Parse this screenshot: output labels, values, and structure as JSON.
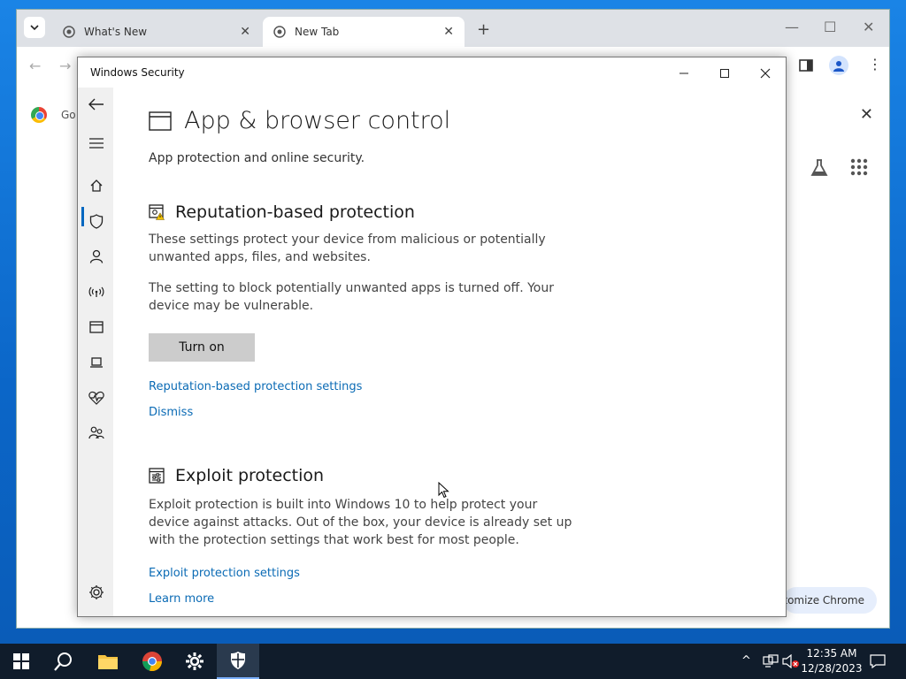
{
  "chrome": {
    "tabs": [
      {
        "label": "What's New"
      },
      {
        "label": "New Tab"
      }
    ],
    "bookmark_partial": "Go",
    "customize_label": "tomize Chrome"
  },
  "ws": {
    "window_title": "Windows Security",
    "page_title": "App & browser control",
    "page_subtitle": "App protection and online security.",
    "reputation": {
      "title": "Reputation-based protection",
      "desc": "These settings protect your device from malicious or potentially unwanted apps, files, and websites.",
      "warning": "The setting to block potentially unwanted apps is turned off. Your device may be vulnerable.",
      "button": "Turn on",
      "settings_link": "Reputation-based protection settings",
      "dismiss_link": "Dismiss"
    },
    "exploit": {
      "title": "Exploit protection",
      "desc": "Exploit protection is built into Windows 10 to help protect your device against attacks.  Out of the box, your device is already set up with the protection settings that work best for most people.",
      "settings_link": "Exploit protection settings",
      "learn_link": "Learn more"
    },
    "accent_color": "#0067c0",
    "link_color": "#0b6bb5"
  },
  "taskbar": {
    "time": "12:35 AM",
    "date": "12/28/2023"
  }
}
